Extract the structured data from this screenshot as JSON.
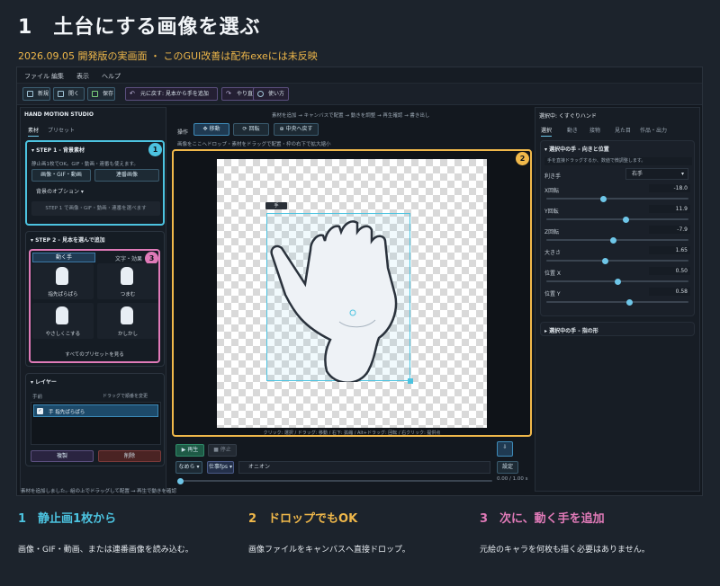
{
  "header": {
    "title": "1　土台にする画像を選ぶ",
    "subtitle": "2026.09.05 開発版の実画面 ・ このGUI改善は配布exeには未反映"
  },
  "menu": [
    "ファイル",
    "編集",
    "表示",
    "ヘルプ"
  ],
  "toolbar": {
    "new": "新規",
    "open": "開く",
    "save": "保存",
    "undo": "元に戻す: 見本から手を追加",
    "redo": "やり直す",
    "help": "使い方"
  },
  "left": {
    "app_name": "HAND MOTION STUDIO",
    "tabs": [
      "素材",
      "プリセット"
    ],
    "step1": {
      "title": "STEP 1 - 背景素材",
      "desc": "静止画1枚でOK。GIF・動画・連番も使えます。",
      "btn_image": "画像・GIF・動画",
      "btn_seq": "連番画像",
      "bg_option": "背景のオプション",
      "status": "STEP 1 で画像・GIF・動画・連番を選べます"
    },
    "step2": {
      "title": "STEP 2 - 見本を選んで追加",
      "tabs": [
        "動く手",
        "文字・効果"
      ],
      "cards": [
        "指先ぱらぱら",
        "つまむ",
        "やさしくこする",
        "かしかし"
      ],
      "all": "すべてのプリセットを見る"
    },
    "layer": {
      "title": "レイヤー",
      "col1": "手前",
      "col2": "ドラッグで順番を変更",
      "item": "手  指先ぱらぱら",
      "dup": "複製",
      "del": "削除"
    }
  },
  "center": {
    "steps": "素材を追加 → キャンバスで配置 → 動きを調整 → 再生確認 → 書き出し",
    "ops_label": "操作",
    "move": "移動",
    "rotate": "回転",
    "center": "中央へ戻す",
    "hint": "画像をここへドロップ・素材をドラッグで配置・枠の右下で拡大縮小",
    "hand_tag": "手",
    "canvas_hint": "クリック: 選択 / ドラッグ: 移動 / 右下: 拡縮 / Alt+ドラッグ: 回転 / 右クリック: 提供点",
    "play": "再生",
    "stop": "停止",
    "smooth": "なめら",
    "speed": "仕事fps",
    "mode": "オニオン",
    "settings": "設定",
    "time": "0.00 / 1.00 s"
  },
  "right": {
    "title": "選択中: くすぐりハンド",
    "tabs": [
      "選択",
      "動き",
      "接物",
      "見た目",
      "作品・出力"
    ],
    "section": "選択中の手 - 向きと位置",
    "note": "手を直接ドラッグするか、数値で微調整します。",
    "hand_label": "利き手",
    "hand_value": "右手",
    "params": [
      {
        "label": "X回転",
        "value": "-18.0",
        "pos": 0.4
      },
      {
        "label": "Y回転",
        "value": "11.9",
        "pos": 0.56
      },
      {
        "label": "Z回転",
        "value": "-7.9",
        "pos": 0.47
      },
      {
        "label": "大きさ",
        "value": "1.65",
        "pos": 0.41
      },
      {
        "label": "位置 X",
        "value": "0.50",
        "pos": 0.5
      },
      {
        "label": "位置 Y",
        "value": "0.58",
        "pos": 0.58
      }
    ],
    "section2": "選択中の手 - 指の形"
  },
  "statusbar": "素材を追加しました。組の上でドラッグして配置 → 再生で動きを確認",
  "badges": [
    "1",
    "2",
    "3"
  ],
  "bottom": [
    {
      "head": "1　静止画1枚から",
      "text": "画像・GIF・動画、または連番画像を読み込む。",
      "color": "#4cc3e0"
    },
    {
      "head": "2　ドロップでもOK",
      "text": "画像ファイルをキャンバスへ直接ドロップ。",
      "color": "#f0b84a"
    },
    {
      "head": "3　次に、動く手を追加",
      "text": "元絵のキャラを何枚も描く必要はありません。",
      "color": "#e07ab8"
    }
  ]
}
